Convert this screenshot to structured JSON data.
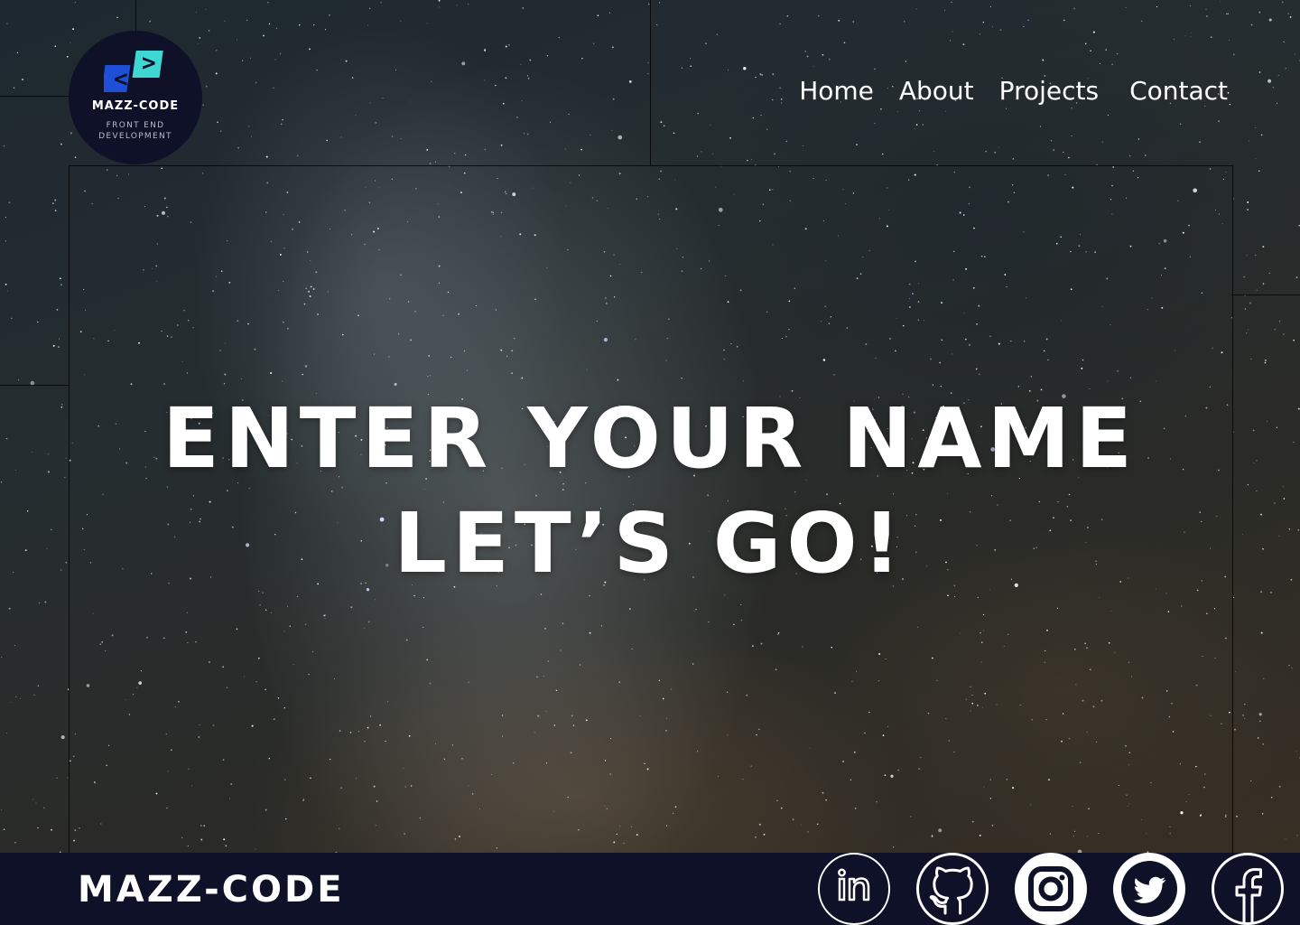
{
  "header": {
    "logo": {
      "name": "MAZZ-CODE",
      "tagline": "FRONT END DEVELOPMENT",
      "colors": {
        "background": "#0e1128",
        "left_tile": "#1f4fd6",
        "right_tile": "#3fd7d2"
      }
    },
    "nav": [
      {
        "label": "Home"
      },
      {
        "label": "About"
      },
      {
        "label": "Projects"
      },
      {
        "label": "Contact"
      }
    ]
  },
  "hero": {
    "line1": "ENTER YOUR NAME",
    "line2": "LET’S GO!"
  },
  "footer": {
    "brand": "MAZZ-CODE",
    "background": "#0e1128",
    "social": [
      {
        "icon": "linkedin-icon"
      },
      {
        "icon": "github-icon"
      },
      {
        "icon": "instagram-icon"
      },
      {
        "icon": "twitter-icon"
      },
      {
        "icon": "facebook-icon"
      }
    ]
  },
  "background": {
    "description_icon": "starry-sky-image"
  }
}
